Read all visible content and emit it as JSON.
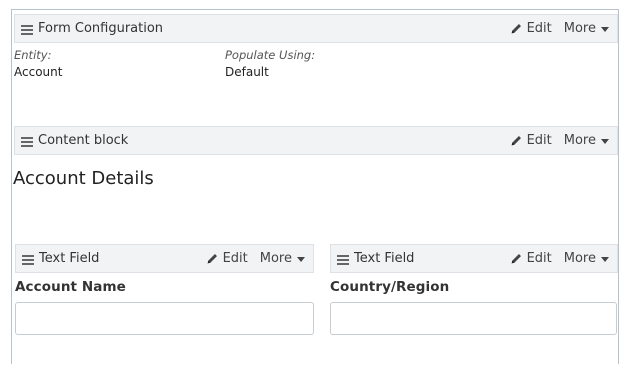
{
  "form_configuration": {
    "title": "Form Configuration",
    "edit_label": "Edit",
    "more_label": "More",
    "entity_label": "Entity:",
    "entity_value": "Account",
    "populate_label": "Populate Using:",
    "populate_value": "Default"
  },
  "content_block": {
    "title": "Content block",
    "edit_label": "Edit",
    "more_label": "More",
    "heading": "Account Details"
  },
  "text_fields": [
    {
      "title": "Text Field",
      "edit_label": "Edit",
      "more_label": "More",
      "field_label": "Account Name",
      "value": ""
    },
    {
      "title": "Text Field",
      "edit_label": "Edit",
      "more_label": "More",
      "field_label": "Country/Region",
      "value": ""
    }
  ]
}
